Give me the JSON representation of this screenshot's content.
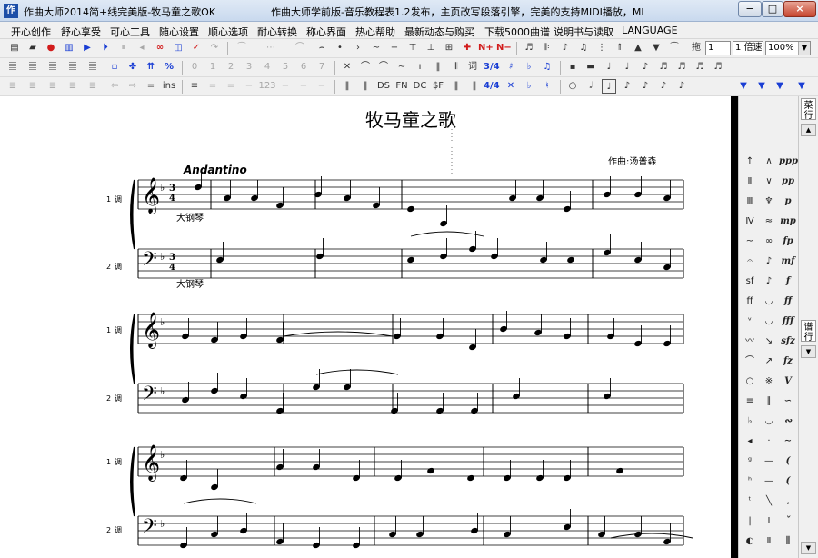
{
  "window": {
    "title": "作曲大师2014简+线完美版-牧马童之歌OK",
    "marquee": "作曲大师学前版-音乐教程表1.2发布，主页改写段落引擎，完美的支持MIDI播放，MI",
    "controls": [
      "−",
      "□",
      "×"
    ]
  },
  "menu": [
    "开心创作",
    "舒心享受",
    "可心工具",
    "随心设置",
    "顺心选项",
    "耐心转换",
    "称心界面",
    "热心帮助",
    "最新动态与购买",
    "下载5000曲谱",
    "说明书与读取",
    "LANGUAGE"
  ],
  "toolbar1": {
    "lyric_label": "拖",
    "lyric_value": "1",
    "tempo_label": "倍速",
    "tempo_prefix": "1",
    "zoom": "100%"
  },
  "toolbar2": {
    "numbers": [
      "0",
      "1",
      "2",
      "3",
      "4",
      "5",
      "6",
      "7"
    ],
    "ci_label": "词",
    "fraction": "3/4"
  },
  "toolbar3": {
    "ins_label": "ins",
    "num_label": "123",
    "ds": "DS",
    "fn": "FN",
    "dc": "DC",
    "sf": "$F",
    "fraction": "4/4"
  },
  "score": {
    "title": "牧马童之歌",
    "tempo": "Andantino",
    "composer": "作曲:汤普森",
    "dynamics_label": "大钢琴",
    "staff_numbers": [
      "1",
      "2"
    ],
    "staff_label": "调",
    "time_sig": [
      "3",
      "4"
    ]
  },
  "palette": {
    "left_col": [
      "↑",
      "Ⅱ",
      "Ⅲ",
      "Ⅳ",
      "~",
      "𝄐",
      "sf",
      "ff",
      "ᵛ",
      "〰",
      "⌒",
      "○",
      "≡",
      "♭",
      "◂",
      "ᵍ",
      "ʰ",
      "ᵗ",
      "|",
      "◐"
    ],
    "mid_col": [
      "∧",
      "∨",
      "♆",
      "≈",
      "∞",
      "♪",
      "♪",
      "◡",
      "◡",
      "↘",
      "↗",
      "※",
      "∥",
      "◡",
      "·",
      "—",
      "—",
      "╲",
      "Ⅰ",
      "Ⅱ"
    ],
    "right_col": [
      "ppp",
      "pp",
      "p",
      "mp",
      "fp",
      "mf",
      "f",
      "ff",
      "fff",
      "sfz",
      "fz",
      "Ⅴ",
      "∽",
      "∾",
      "∼",
      "(",
      "(",
      "ˌ",
      "ˇ",
      "∥"
    ],
    "tab_top": "菜行",
    "tab_mid": "谱行"
  },
  "colors": {
    "accent": "#1a3ed4",
    "red": "#d21c1c",
    "scorebar": "#000000"
  }
}
